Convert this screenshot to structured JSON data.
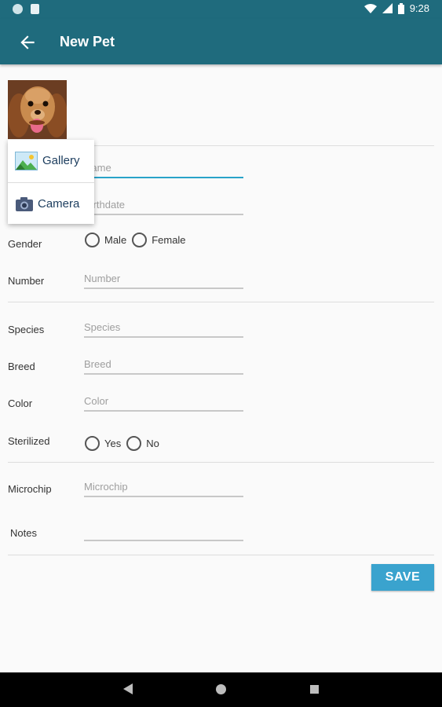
{
  "status_bar": {
    "time": "9:28",
    "icons": [
      "notification-dot-icon",
      "sd-card-icon",
      "wifi-icon",
      "signal-icon",
      "battery-icon"
    ]
  },
  "app_bar": {
    "title": "New Pet",
    "back_icon": "arrow-left-icon"
  },
  "photo_popup": {
    "items": [
      {
        "label": "Gallery",
        "icon": "gallery-icon"
      },
      {
        "label": "Camera",
        "icon": "camera-icon"
      }
    ]
  },
  "form": {
    "name": {
      "placeholder": "Name",
      "value": ""
    },
    "birthdate": {
      "placeholder": "Birthdate",
      "value": ""
    },
    "gender": {
      "label": "Gender",
      "options": [
        "Male",
        "Female"
      ]
    },
    "number": {
      "label": "Number",
      "placeholder": "Number",
      "value": ""
    },
    "species": {
      "label": "Species",
      "placeholder": "Species",
      "value": ""
    },
    "breed": {
      "label": "Breed",
      "placeholder": "Breed",
      "value": ""
    },
    "color": {
      "label": "Color",
      "placeholder": "Color",
      "value": ""
    },
    "sterilized": {
      "label": "Sterilized",
      "options": [
        "Yes",
        "No"
      ]
    },
    "microchip": {
      "label": "Microchip",
      "placeholder": "Microchip",
      "value": ""
    },
    "notes": {
      "label": "Notes",
      "placeholder": "",
      "value": ""
    }
  },
  "save_label": "SAVE",
  "nav_bar": {
    "icons": [
      "back-triangle-icon",
      "home-circle-icon",
      "recents-square-icon"
    ]
  },
  "colors": {
    "primary": "#1f6b7d",
    "accent": "#29a3c9",
    "save_button": "#3aa3ce"
  }
}
